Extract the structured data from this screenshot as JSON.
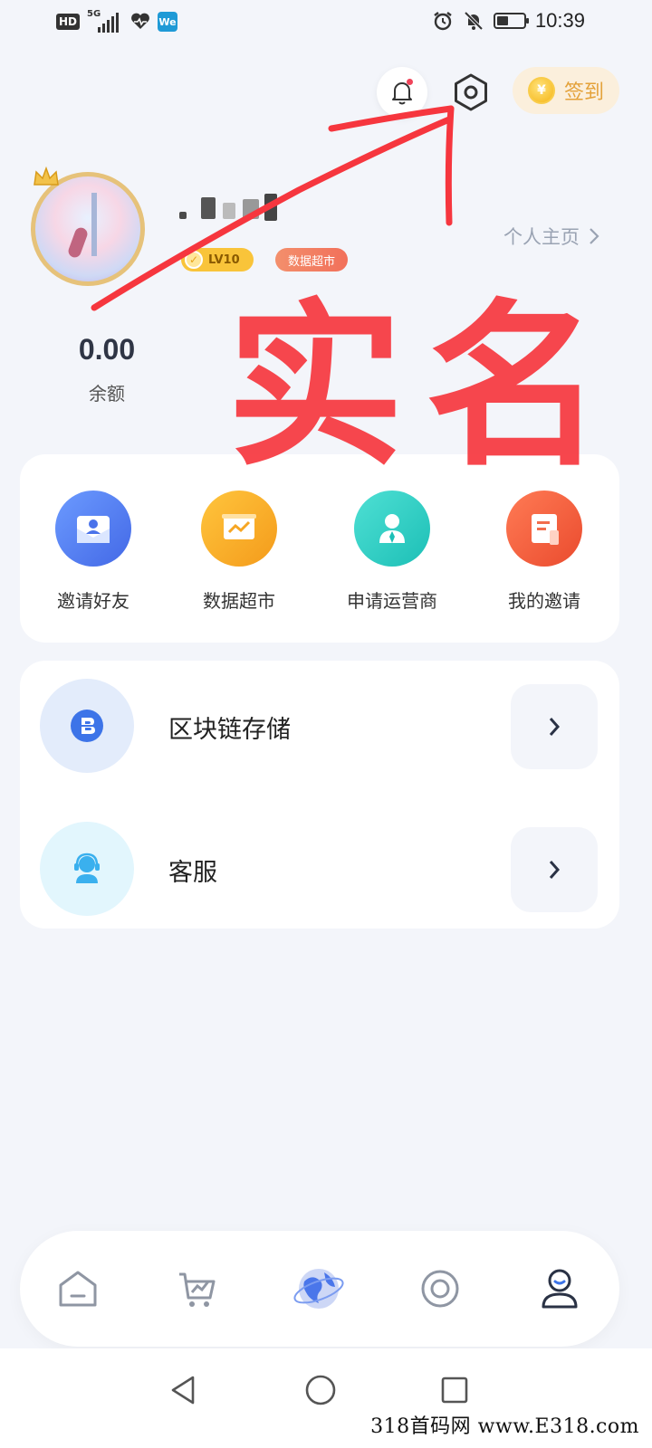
{
  "status_bar": {
    "hd": "HD",
    "network": "5G",
    "we": "We",
    "time": "10:39"
  },
  "header": {
    "checkin_label": "签到",
    "coin_symbol": "¥"
  },
  "profile": {
    "level": "LV10",
    "badge": "数据超市",
    "homepage_link": "个人主页"
  },
  "stats": [
    {
      "value": "0.00",
      "label": "余额"
    }
  ],
  "overlay": {
    "stamp_text": "实名"
  },
  "quick_actions": [
    {
      "label": "邀请好友",
      "icon": "invite-friend-icon",
      "color": "#4f7df0"
    },
    {
      "label": "数据超市",
      "icon": "data-market-icon",
      "color": "#f7a524"
    },
    {
      "label": "申请运营商",
      "icon": "apply-operator-icon",
      "color": "#28cfc6"
    },
    {
      "label": "我的邀请",
      "icon": "my-invites-icon",
      "color": "#f1543b"
    }
  ],
  "menu": [
    {
      "label": "区块链存储",
      "icon": "blockchain-icon"
    },
    {
      "label": "客服",
      "icon": "customer-service-icon"
    }
  ],
  "bottom_nav": [
    "home-icon",
    "market-icon",
    "globe-icon",
    "discover-icon",
    "profile-icon"
  ],
  "watermark": "318首码网 www.E318.com",
  "colors": {
    "annotation_red": "#f6363e",
    "accent_gold": "#e4a23a",
    "bg": "#f3f5fa"
  }
}
